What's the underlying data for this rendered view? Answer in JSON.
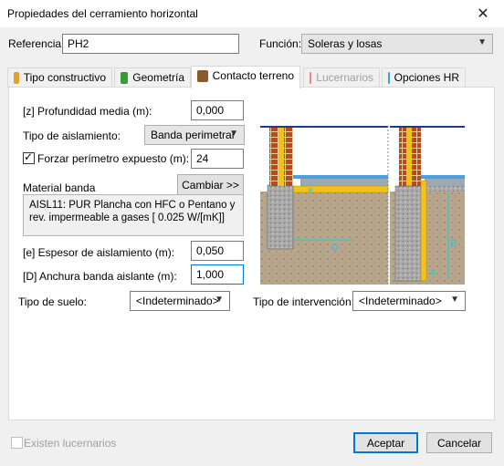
{
  "window": {
    "title": "Propiedades del cerramiento horizontal",
    "close_glyph": "✕"
  },
  "header": {
    "referencia_label": "Referencia:",
    "referencia_value": "PH2",
    "funcion_label": "Función:",
    "funcion_value": "Soleras y losas"
  },
  "tabs": [
    {
      "label": "Tipo constructivo",
      "icon": "tipo-constructivo-icon",
      "color": "#e3a032"
    },
    {
      "label": "Geometría",
      "icon": "geometria-icon",
      "color": "#3a9a3a"
    },
    {
      "label": "Contacto terreno",
      "icon": "contacto-terreno-icon",
      "color": "#8b5a2b"
    },
    {
      "label": "Lucernarios",
      "icon": "lucernarios-icon",
      "color": "#d6373e"
    },
    {
      "label": "Opciones HR",
      "icon": "opciones-hr-icon",
      "color": "#3aa0d8"
    }
  ],
  "form": {
    "profundidad_label": "[z] Profundidad media (m):",
    "profundidad_value": "0,000",
    "aislamiento_label": "Tipo de aislamiento:",
    "aislamiento_value": "Banda perimetral",
    "forzar_label": "Forzar perímetro expuesto (m):",
    "forzar_value": "24",
    "material_label": "Material banda",
    "cambiar_label": "Cambiar >>",
    "material_text": "AISL11: PUR Plancha con HFC o Pentano y rev. impermeable a gases [ 0.025 W/[mK]]",
    "espesor_label": "[e] Espesor de aislamiento (m):",
    "espesor_value": "0,050",
    "anchura_label": "[D] Anchura banda aislante (m):",
    "anchura_value": "1,000",
    "suelo_label": "Tipo de suelo:",
    "suelo_value": "<Indeterminado>",
    "intervencion_label": "Tipo de intervención:",
    "intervencion_value": "<Indeterminado>"
  },
  "diagram": {
    "e": "e",
    "d": "D"
  },
  "footer": {
    "lucernarios_label": "Existen lucernarios",
    "aceptar_label": "Aceptar",
    "cancelar_label": "Cancelar"
  },
  "colors": {
    "accent": "#0078d7",
    "soil": "#b8a68c",
    "insulation": "#f2c21b",
    "brick": "#c0461e"
  }
}
